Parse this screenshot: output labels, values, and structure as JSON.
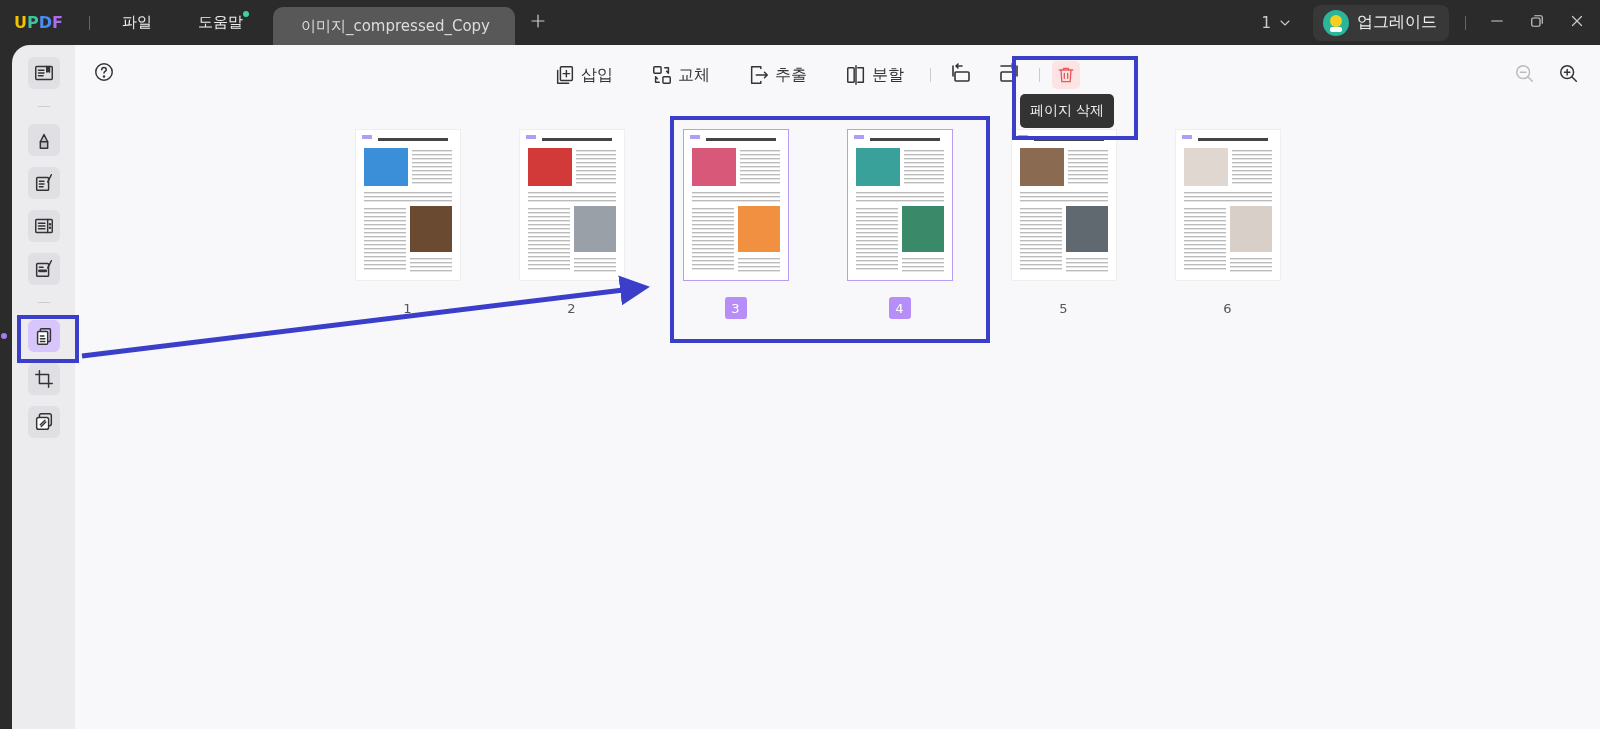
{
  "app": {
    "logo": "UPDF"
  },
  "menu": [
    {
      "label": "파일",
      "badge": false
    },
    {
      "label": "도움말",
      "badge": true
    }
  ],
  "tab": {
    "title": "이미지_compressed_Copy"
  },
  "page_select": {
    "value": "1"
  },
  "upgrade": {
    "label": "업그레이드"
  },
  "sidebar": {
    "items": [
      {
        "selected": false
      },
      {
        "selected": false
      },
      {
        "selected": false
      },
      {
        "selected": false
      },
      {
        "selected": false
      },
      {
        "selected": true
      },
      {
        "selected": false
      },
      {
        "selected": false
      }
    ]
  },
  "toolbar": {
    "buttons": [
      {
        "label": "삽입"
      },
      {
        "label": "교체"
      },
      {
        "label": "추출"
      },
      {
        "label": "분할"
      }
    ],
    "delete_button": {
      "hovered": true,
      "tooltip": "페이지 삭제"
    },
    "zoom_out": {
      "disabled": true
    },
    "zoom_in": {
      "disabled": false
    }
  },
  "pages": [
    {
      "label": "1",
      "selected": false
    },
    {
      "label": "2",
      "selected": false
    },
    {
      "label": "3",
      "selected": true
    },
    {
      "label": "4",
      "selected": true
    },
    {
      "label": "5",
      "selected": false
    },
    {
      "label": "6",
      "selected": false
    }
  ]
}
